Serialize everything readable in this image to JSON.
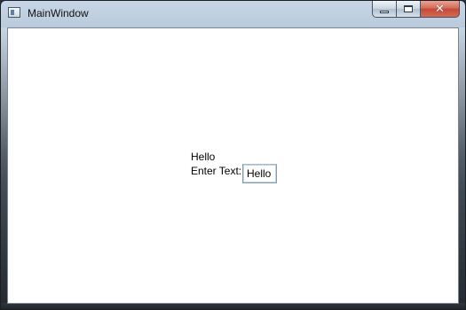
{
  "window": {
    "title": "MainWindow",
    "icon": "window-icon",
    "controls": {
      "minimize_icon": "minimize-icon",
      "maximize_icon": "maximize-icon",
      "close_icon": "close-icon",
      "close_glyph": "✕"
    }
  },
  "content": {
    "hello_label": "Hello",
    "enter_label": "Enter Text:",
    "text_input": {
      "value": "Hello"
    }
  },
  "colors": {
    "client_background": "#ffffff",
    "close_button": "#c24a35",
    "input_border": "#7f9db9"
  }
}
